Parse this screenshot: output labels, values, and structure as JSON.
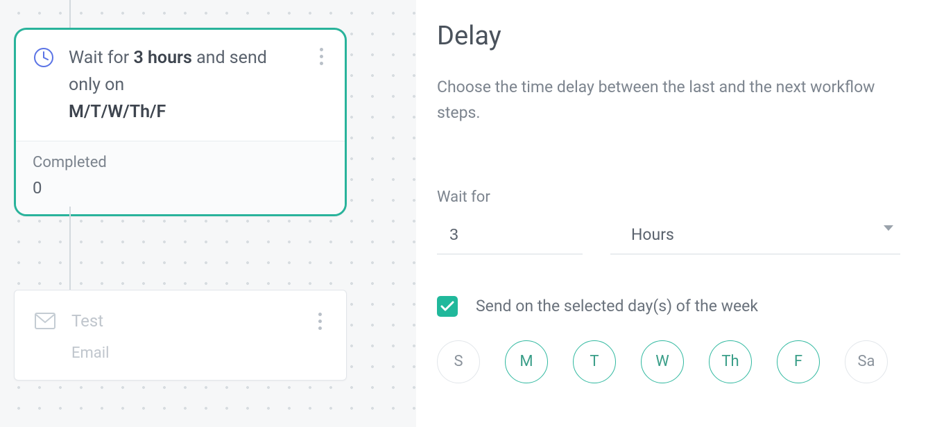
{
  "canvas": {
    "delay_node": {
      "wait_prefix": "Wait for ",
      "wait_value": "3 hours",
      "wait_mid": " and send only on ",
      "days_text": "M/T/W/Th/F",
      "completed_label": "Completed",
      "completed_value": "0"
    },
    "email_node": {
      "title": "Test",
      "subtitle": "Email"
    }
  },
  "panel": {
    "title": "Delay",
    "description": "Choose the time delay between the last and the next workflow steps.",
    "wait_label": "Wait for",
    "wait_amount": "3",
    "wait_unit": "Hours",
    "send_days_label": "Send on the selected day(s) of the week",
    "days": {
      "S_left": "S",
      "M": "M",
      "T": "T",
      "W": "W",
      "Th": "Th",
      "F": "F",
      "Sa": "Sa"
    }
  }
}
